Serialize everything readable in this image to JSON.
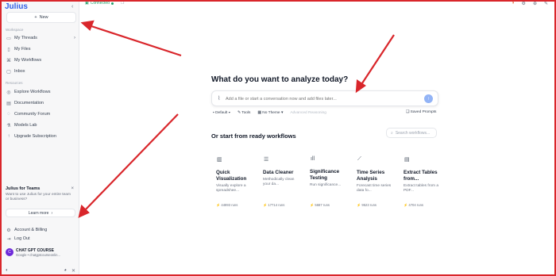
{
  "app": {
    "logo": "Julius"
  },
  "sidebar": {
    "new_label": "New",
    "workspace_title": "Workspace",
    "workspace_items": [
      {
        "label": "My Threads",
        "icon": "chat-icon"
      },
      {
        "label": "My Files",
        "icon": "file-icon"
      },
      {
        "label": "My Workflows",
        "icon": "workflow-icon"
      },
      {
        "label": "Inbox",
        "icon": "inbox-icon"
      }
    ],
    "resources_title": "Resources",
    "resource_items": [
      {
        "label": "Explore Workflows",
        "icon": "compass-icon"
      },
      {
        "label": "Documentation",
        "icon": "book-icon"
      },
      {
        "label": "Community Forum",
        "icon": "forum-icon"
      },
      {
        "label": "Models Lab",
        "icon": "flask-icon"
      },
      {
        "label": "Upgrade Subscription",
        "icon": "upgrade-icon"
      }
    ],
    "teams": {
      "title": "Julius for Teams",
      "description": "Want to use Julius for your entire team or business?",
      "learn_more": "Learn more"
    },
    "account_label": "Account & Billing",
    "logout_label": "Log Out",
    "user": {
      "initial": "C",
      "name": "CHAT GPT COURSE",
      "email": "Google • chatgptcourseonlin..."
    }
  },
  "topbar": {
    "status": "Connected"
  },
  "main": {
    "headline": "What do you want to analyze today?",
    "prompt_placeholder": "Add a file or start a conversation now and add files later...",
    "toolbar": {
      "model": "Default",
      "tools": "Tools",
      "theme": "No Theme",
      "reasoning": "Advanced Reasoning",
      "saved_prompts": "Saved Prompts"
    },
    "ready_title": "Or start from ready workflows",
    "search_placeholder": "Search workflows...",
    "workflows": [
      {
        "title": "Quick Visualization",
        "desc": "Visually explore a spreadshee...",
        "runs": "44893 runs",
        "icon": "chart-bar-icon"
      },
      {
        "title": "Data Cleaner",
        "desc": "Methodically clean your da...",
        "runs": "17714 runs",
        "icon": "sliders-icon"
      },
      {
        "title": "Significance Testing",
        "desc": "Run significance...",
        "runs": "5687 runs",
        "icon": "bar-small-icon"
      },
      {
        "title": "Time Series Analysis",
        "desc": "Forecast time series data fo...",
        "runs": "9523 runs",
        "icon": "line-chart-icon"
      },
      {
        "title": "Extract Tables from...",
        "desc": "Extract tables from a PDF...",
        "runs": "4704 runs",
        "icon": "document-icon"
      }
    ]
  },
  "colors": {
    "brand": "#2f5ee8",
    "annotation_arrow": "#d9262b",
    "connected": "#22a06b",
    "send_button": "#93b4f6"
  }
}
